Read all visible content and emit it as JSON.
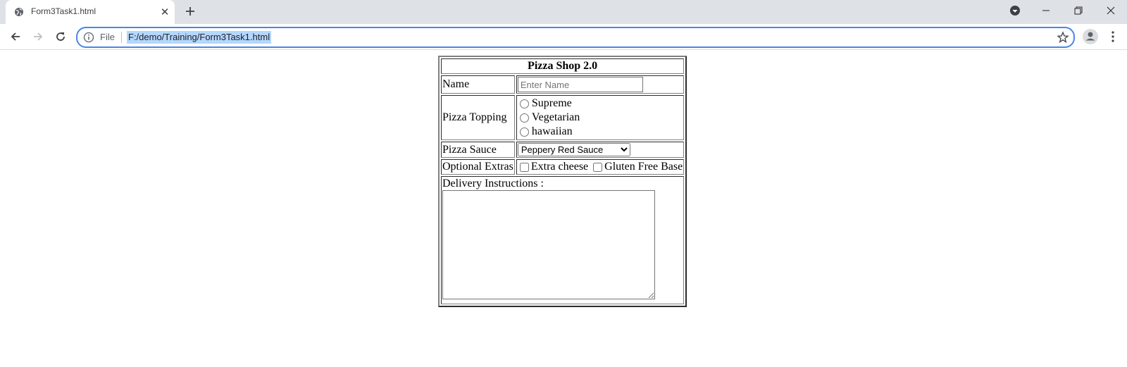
{
  "browser": {
    "tab_title": "Form3Task1.html",
    "tab_close": "✕",
    "new_tab": "+",
    "url_scheme": "File",
    "url": "F:/demo/Training/Form3Task1.html",
    "accent_color": "#4a86e8"
  },
  "form": {
    "heading": "Pizza Shop 2.0",
    "name_label": "Name",
    "name_placeholder": "Enter Name",
    "topping_label": "Pizza Topping",
    "toppings": [
      "Supreme",
      "Vegetarian",
      "hawaiian"
    ],
    "sauce_label": "Pizza Sauce",
    "sauce_selected": "Peppery Red Sauce",
    "extras_label": "Optional Extras",
    "extras": [
      "Extra cheese",
      "Gluten Free Base"
    ],
    "delivery_label": "Delivery Instructions :"
  }
}
